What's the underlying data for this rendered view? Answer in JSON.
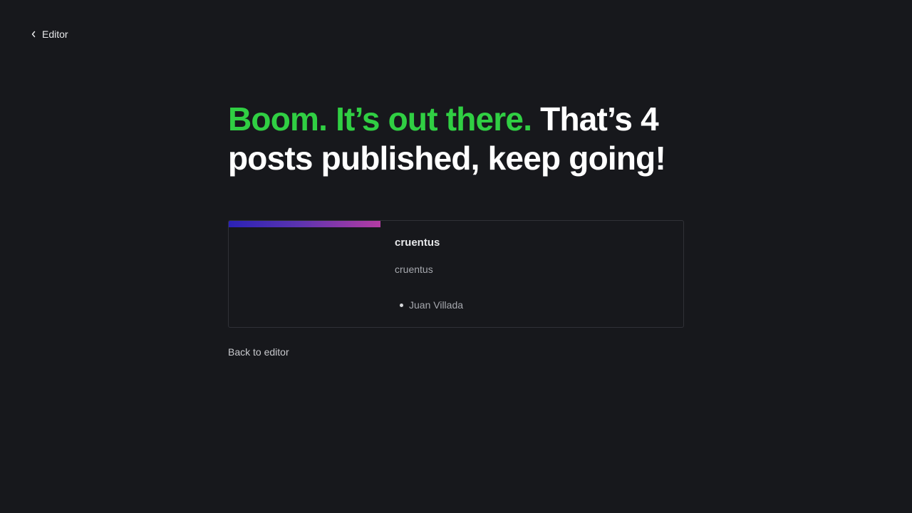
{
  "nav": {
    "back_label": "Editor"
  },
  "headline": {
    "accent": "Boom. It’s out there.",
    "rest": " That’s 4 posts published, keep going!"
  },
  "post_card": {
    "title": "cruentus",
    "excerpt": "cruentus",
    "authors": [
      "Juan Villada"
    ]
  },
  "footer": {
    "back_to_editor": "Back to editor"
  },
  "colors": {
    "background": "#17181c",
    "accent_green": "#30cf43",
    "text": "#ffffff",
    "muted": "#a6a8ae",
    "gradient_start": "#2b22b6",
    "gradient_end": "#b43ca3"
  },
  "icons": {
    "back": "chevron-left-icon"
  }
}
